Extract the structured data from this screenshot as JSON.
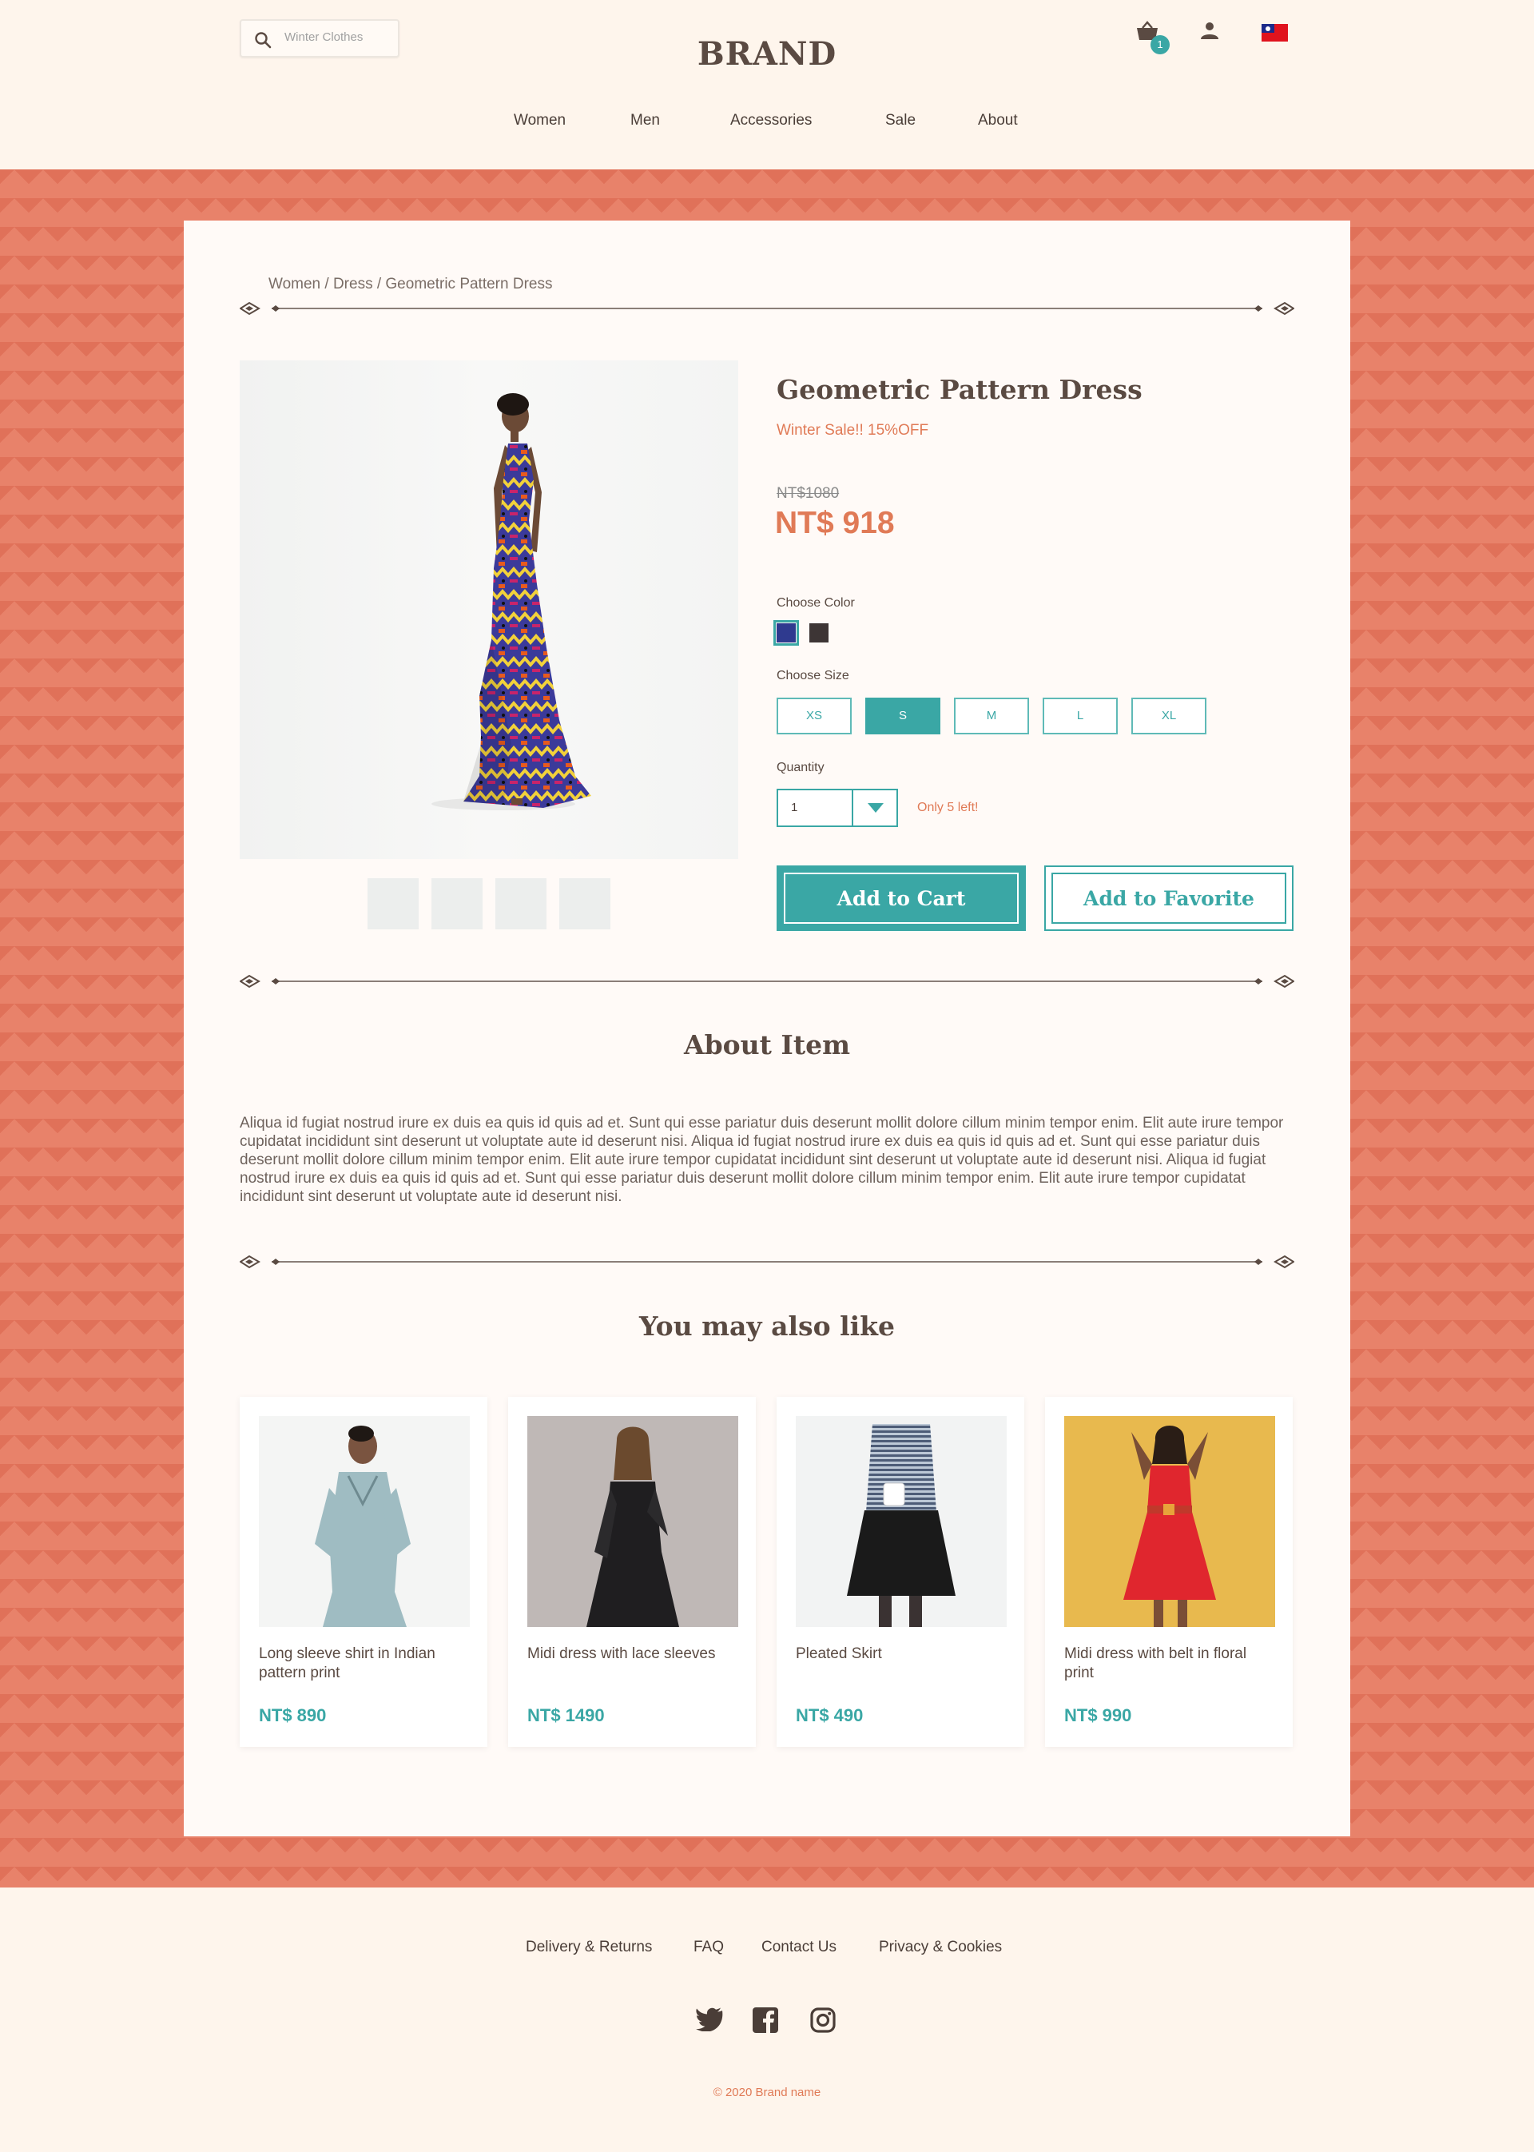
{
  "header": {
    "search_placeholder": "Winter Clothes",
    "brand": "BRAND",
    "cart_count": "1",
    "nav": [
      "Women",
      "Men",
      "Accessories",
      "Sale",
      "About"
    ]
  },
  "breadcrumb": "Women / Dress / Geometric Pattern Dress",
  "product": {
    "title": "Geometric Pattern Dress",
    "sale_text": "Winter Sale!! 15%OFF",
    "old_price": "NT$1080",
    "price": "NT$ 918",
    "color_label": "Choose Color",
    "colors": [
      "#2f3a8f",
      "#3d3535"
    ],
    "size_label": "Choose Size",
    "sizes": [
      "XS",
      "S",
      "M",
      "L",
      "XL"
    ],
    "selected_size": "S",
    "quantity_label": "Quantity",
    "quantity": "1",
    "stock_note": "Only 5 left!",
    "add_to_cart": "Add to Cart",
    "add_to_favorite": "Add to Favorite"
  },
  "about": {
    "title": "About Item",
    "text": "Aliqua id fugiat nostrud irure ex duis ea quis id quis ad et. Sunt qui esse pariatur duis deserunt mollit dolore cillum minim tempor enim. Elit aute irure tempor cupidatat incididunt sint deserunt ut voluptate aute id deserunt nisi. Aliqua id fugiat nostrud irure ex duis ea quis id quis ad et. Sunt qui esse pariatur duis deserunt mollit dolore cillum minim tempor enim. Elit aute irure tempor cupidatat incididunt sint deserunt ut voluptate aute id deserunt nisi. Aliqua id fugiat nostrud irure ex duis ea quis id quis ad et. Sunt qui esse pariatur duis deserunt mollit dolore cillum minim tempor enim. Elit aute irure tempor cupidatat incididunt sint deserunt ut voluptate aute id deserunt nisi."
  },
  "related": {
    "title": "You may also like",
    "items": [
      {
        "name": "Long sleeve shirt in Indian pattern print",
        "price": "NT$ 890"
      },
      {
        "name": "Midi dress with lace sleeves",
        "price": "NT$ 1490"
      },
      {
        "name": "Pleated Skirt",
        "price": "NT$ 490"
      },
      {
        "name": "Midi dress with belt in floral print",
        "price": "NT$ 990"
      }
    ]
  },
  "footer": {
    "links": [
      "Delivery & Returns",
      "FAQ",
      "Contact Us",
      "Privacy & Cookies"
    ],
    "social_icons": [
      "twitter-icon",
      "facebook-icon",
      "instagram-icon"
    ],
    "copyright": "© 2020 Brand name"
  },
  "colors": {
    "accent": "#3aa7a5",
    "sale": "#e07a56",
    "band": "#e8826a",
    "text": "#5a4a42",
    "background": "#fef5ec"
  }
}
